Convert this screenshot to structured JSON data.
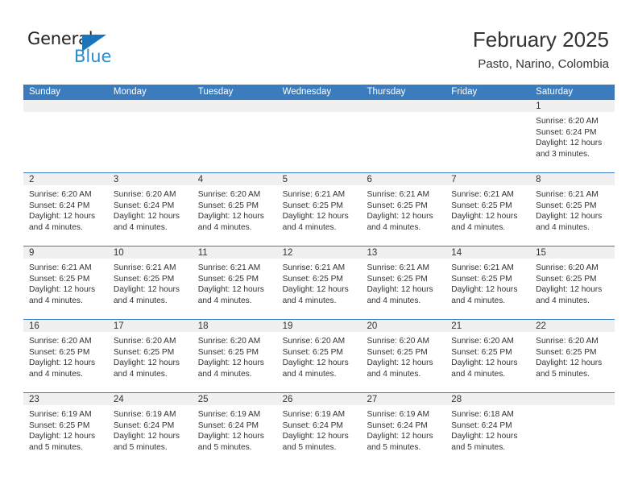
{
  "brand": {
    "name_top": "General",
    "name_bottom": "Blue",
    "triangle_icon": "blue-triangle-icon",
    "accent_color": "#2e8bc9"
  },
  "header": {
    "title": "February 2025",
    "subtitle": "Pasto, Narino, Colombia"
  },
  "theme": {
    "header_row_bg": "#3a7cbe",
    "day_header_bg": "#f0f0f0",
    "row_separator": "#3a7cbe",
    "text": "#333333"
  },
  "weekdays": [
    "Sunday",
    "Monday",
    "Tuesday",
    "Wednesday",
    "Thursday",
    "Friday",
    "Saturday"
  ],
  "weeks": [
    [
      {
        "empty": true
      },
      {
        "empty": true
      },
      {
        "empty": true
      },
      {
        "empty": true
      },
      {
        "empty": true
      },
      {
        "empty": true
      },
      {
        "day": "1",
        "sunrise": "Sunrise: 6:20 AM",
        "sunset": "Sunset: 6:24 PM",
        "daylight1": "Daylight: 12 hours",
        "daylight2": "and 3 minutes."
      }
    ],
    [
      {
        "day": "2",
        "sunrise": "Sunrise: 6:20 AM",
        "sunset": "Sunset: 6:24 PM",
        "daylight1": "Daylight: 12 hours",
        "daylight2": "and 4 minutes."
      },
      {
        "day": "3",
        "sunrise": "Sunrise: 6:20 AM",
        "sunset": "Sunset: 6:24 PM",
        "daylight1": "Daylight: 12 hours",
        "daylight2": "and 4 minutes."
      },
      {
        "day": "4",
        "sunrise": "Sunrise: 6:20 AM",
        "sunset": "Sunset: 6:25 PM",
        "daylight1": "Daylight: 12 hours",
        "daylight2": "and 4 minutes."
      },
      {
        "day": "5",
        "sunrise": "Sunrise: 6:21 AM",
        "sunset": "Sunset: 6:25 PM",
        "daylight1": "Daylight: 12 hours",
        "daylight2": "and 4 minutes."
      },
      {
        "day": "6",
        "sunrise": "Sunrise: 6:21 AM",
        "sunset": "Sunset: 6:25 PM",
        "daylight1": "Daylight: 12 hours",
        "daylight2": "and 4 minutes."
      },
      {
        "day": "7",
        "sunrise": "Sunrise: 6:21 AM",
        "sunset": "Sunset: 6:25 PM",
        "daylight1": "Daylight: 12 hours",
        "daylight2": "and 4 minutes."
      },
      {
        "day": "8",
        "sunrise": "Sunrise: 6:21 AM",
        "sunset": "Sunset: 6:25 PM",
        "daylight1": "Daylight: 12 hours",
        "daylight2": "and 4 minutes."
      }
    ],
    [
      {
        "day": "9",
        "sunrise": "Sunrise: 6:21 AM",
        "sunset": "Sunset: 6:25 PM",
        "daylight1": "Daylight: 12 hours",
        "daylight2": "and 4 minutes."
      },
      {
        "day": "10",
        "sunrise": "Sunrise: 6:21 AM",
        "sunset": "Sunset: 6:25 PM",
        "daylight1": "Daylight: 12 hours",
        "daylight2": "and 4 minutes."
      },
      {
        "day": "11",
        "sunrise": "Sunrise: 6:21 AM",
        "sunset": "Sunset: 6:25 PM",
        "daylight1": "Daylight: 12 hours",
        "daylight2": "and 4 minutes."
      },
      {
        "day": "12",
        "sunrise": "Sunrise: 6:21 AM",
        "sunset": "Sunset: 6:25 PM",
        "daylight1": "Daylight: 12 hours",
        "daylight2": "and 4 minutes."
      },
      {
        "day": "13",
        "sunrise": "Sunrise: 6:21 AM",
        "sunset": "Sunset: 6:25 PM",
        "daylight1": "Daylight: 12 hours",
        "daylight2": "and 4 minutes."
      },
      {
        "day": "14",
        "sunrise": "Sunrise: 6:21 AM",
        "sunset": "Sunset: 6:25 PM",
        "daylight1": "Daylight: 12 hours",
        "daylight2": "and 4 minutes."
      },
      {
        "day": "15",
        "sunrise": "Sunrise: 6:20 AM",
        "sunset": "Sunset: 6:25 PM",
        "daylight1": "Daylight: 12 hours",
        "daylight2": "and 4 minutes."
      }
    ],
    [
      {
        "day": "16",
        "sunrise": "Sunrise: 6:20 AM",
        "sunset": "Sunset: 6:25 PM",
        "daylight1": "Daylight: 12 hours",
        "daylight2": "and 4 minutes."
      },
      {
        "day": "17",
        "sunrise": "Sunrise: 6:20 AM",
        "sunset": "Sunset: 6:25 PM",
        "daylight1": "Daylight: 12 hours",
        "daylight2": "and 4 minutes."
      },
      {
        "day": "18",
        "sunrise": "Sunrise: 6:20 AM",
        "sunset": "Sunset: 6:25 PM",
        "daylight1": "Daylight: 12 hours",
        "daylight2": "and 4 minutes."
      },
      {
        "day": "19",
        "sunrise": "Sunrise: 6:20 AM",
        "sunset": "Sunset: 6:25 PM",
        "daylight1": "Daylight: 12 hours",
        "daylight2": "and 4 minutes."
      },
      {
        "day": "20",
        "sunrise": "Sunrise: 6:20 AM",
        "sunset": "Sunset: 6:25 PM",
        "daylight1": "Daylight: 12 hours",
        "daylight2": "and 4 minutes."
      },
      {
        "day": "21",
        "sunrise": "Sunrise: 6:20 AM",
        "sunset": "Sunset: 6:25 PM",
        "daylight1": "Daylight: 12 hours",
        "daylight2": "and 4 minutes."
      },
      {
        "day": "22",
        "sunrise": "Sunrise: 6:20 AM",
        "sunset": "Sunset: 6:25 PM",
        "daylight1": "Daylight: 12 hours",
        "daylight2": "and 5 minutes."
      }
    ],
    [
      {
        "day": "23",
        "sunrise": "Sunrise: 6:19 AM",
        "sunset": "Sunset: 6:25 PM",
        "daylight1": "Daylight: 12 hours",
        "daylight2": "and 5 minutes."
      },
      {
        "day": "24",
        "sunrise": "Sunrise: 6:19 AM",
        "sunset": "Sunset: 6:24 PM",
        "daylight1": "Daylight: 12 hours",
        "daylight2": "and 5 minutes."
      },
      {
        "day": "25",
        "sunrise": "Sunrise: 6:19 AM",
        "sunset": "Sunset: 6:24 PM",
        "daylight1": "Daylight: 12 hours",
        "daylight2": "and 5 minutes."
      },
      {
        "day": "26",
        "sunrise": "Sunrise: 6:19 AM",
        "sunset": "Sunset: 6:24 PM",
        "daylight1": "Daylight: 12 hours",
        "daylight2": "and 5 minutes."
      },
      {
        "day": "27",
        "sunrise": "Sunrise: 6:19 AM",
        "sunset": "Sunset: 6:24 PM",
        "daylight1": "Daylight: 12 hours",
        "daylight2": "and 5 minutes."
      },
      {
        "day": "28",
        "sunrise": "Sunrise: 6:18 AM",
        "sunset": "Sunset: 6:24 PM",
        "daylight1": "Daylight: 12 hours",
        "daylight2": "and 5 minutes."
      },
      {
        "empty": true
      }
    ]
  ]
}
